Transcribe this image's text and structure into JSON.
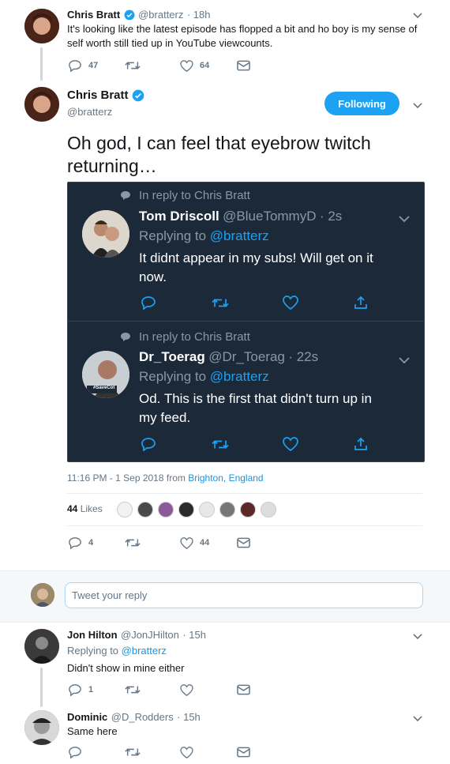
{
  "colors": {
    "accent": "#1da1f2",
    "link": "#1b95e0",
    "dark_bg": "#1c2938",
    "muted": "#657786"
  },
  "tweet1": {
    "name": "Chris Bratt",
    "handle": "@bratterz",
    "time": "· 18h",
    "text_line1": "It's looking like the latest episode has flopped a bit and ho boy is my sense of",
    "text_line2": "self worth still tied up in YouTube viewcounts.",
    "replies": "47",
    "likes": "64"
  },
  "main": {
    "name": "Chris Bratt",
    "handle": "@bratterz",
    "follow_label": "Following",
    "text_line1": "Oh god, I can feel that eyebrow twitch",
    "text_line2": "returning…",
    "timestamp": "11:16 PM - 1 Sep 2018 from ",
    "location": "Brighton, England",
    "likes_count": "44",
    "likes_label": "Likes",
    "reply_count": "4",
    "like_count": "44"
  },
  "embed": [
    {
      "context": "In reply to Chris Bratt",
      "name": "Tom Driscoll",
      "handle": "@BlueTommyD",
      "time": "· 2s",
      "replying_label": "Replying to ",
      "replying_to": "@bratterz",
      "text_line1": "It didnt appear in my subs! Will get on it",
      "text_line2": "now."
    },
    {
      "context": "In reply to Chris Bratt",
      "name": "Dr_Toerag",
      "handle": "@Dr_Toerag",
      "time": "· 22s",
      "replying_label": "Replying to ",
      "replying_to": "@bratterz",
      "text_line1": "Od. This is the first that didn't turn up in",
      "text_line2": "my feed.",
      "avatar_badge": "#SaveCot"
    }
  ],
  "reply_box": {
    "placeholder": "Tweet your reply"
  },
  "replies": [
    {
      "name": "Jon Hilton",
      "handle": "@JonJHilton",
      "time": "· 15h",
      "replying_label": "Replying to ",
      "replying_to": "@bratterz",
      "text": "Didn't show in mine either",
      "reply_count": "1"
    },
    {
      "name": "Dominic",
      "handle": "@D_Rodders",
      "time": "· 15h",
      "text": "Same here"
    }
  ],
  "icons": [
    "reply-icon",
    "retweet-icon",
    "like-icon",
    "dm-icon",
    "share-icon",
    "chevron-down-icon",
    "verified-icon",
    "speech-bubble-icon"
  ]
}
